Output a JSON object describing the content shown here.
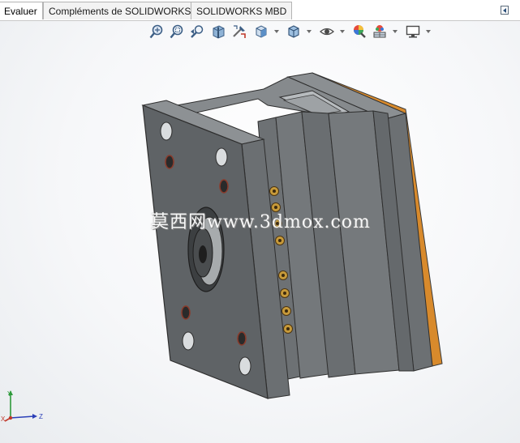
{
  "tabs": [
    {
      "label": "Evaluer",
      "active": true
    },
    {
      "label": "Compléments de SOLIDWORKS",
      "active": false
    },
    {
      "label": "SOLIDWORKS MBD",
      "active": false
    }
  ],
  "heads_up_toolbar": [
    {
      "icon": "zoom-to-fit-icon"
    },
    {
      "icon": "zoom-to-area-icon"
    },
    {
      "icon": "previous-view-icon"
    },
    {
      "icon": "section-view-icon"
    },
    {
      "icon": "dynamic-annotation-views-icon"
    },
    {
      "icon": "view-orientation-icon",
      "dropdown": true
    },
    {
      "icon": "display-style-icon",
      "dropdown": true
    },
    {
      "icon": "hide-show-items-icon",
      "dropdown": true
    },
    {
      "icon": "edit-appearance-icon"
    },
    {
      "icon": "apply-scene-icon",
      "dropdown": true
    },
    {
      "icon": "view-settings-icon",
      "dropdown": true
    }
  ],
  "watermark": "莫西网www.3dmox.com",
  "triad": {
    "x_label": "X",
    "y_label": "Y",
    "z_label": "Z"
  },
  "colors": {
    "mold_face": "#5f6366",
    "mold_side": "#6e7275",
    "mold_top": "#83878a",
    "plate_accent": "#d88a2c",
    "axis_x": "#c0392b",
    "axis_y": "#2e9a3b",
    "axis_z": "#2b3fb8"
  }
}
